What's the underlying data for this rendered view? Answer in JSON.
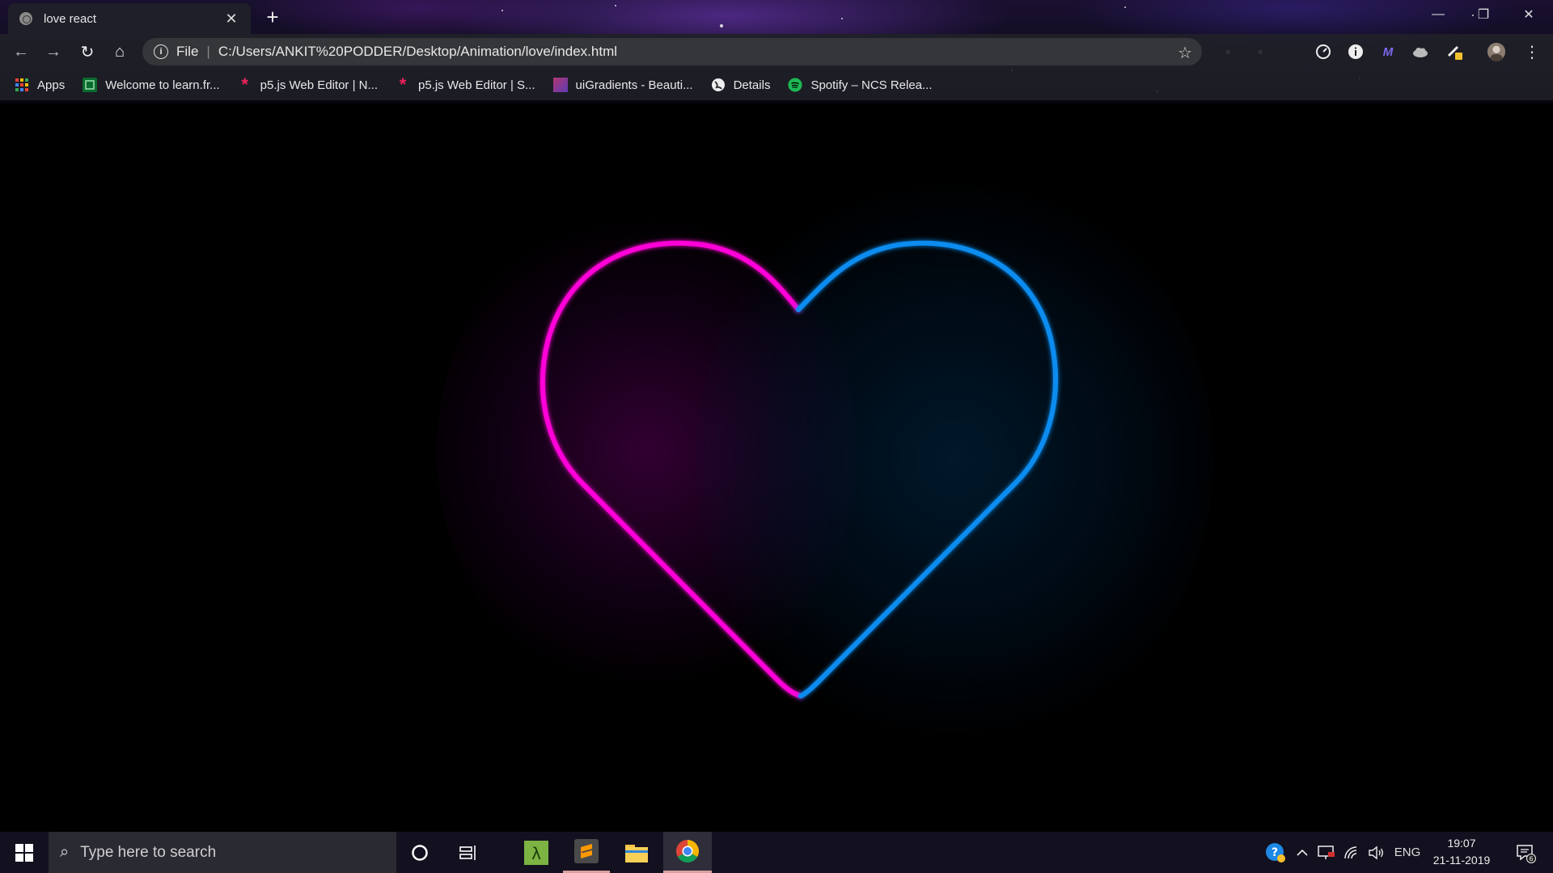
{
  "browser": {
    "tab_title": "love react",
    "new_tab_symbol": "+",
    "close_symbol": "✕",
    "window_controls": {
      "minimize": "—",
      "restore": "❐",
      "close": "✕"
    },
    "nav": {
      "back": "←",
      "forward": "→",
      "reload": "↻",
      "home": "⌂"
    },
    "address": {
      "scheme_label": "File",
      "separator": "|",
      "url": "C:/Users/ANKIT%20PODDER/Desktop/Animation/love/index.html"
    },
    "bookmark_star": "☆",
    "menu_dots": "⋮"
  },
  "bookmarks": [
    {
      "label": "Apps",
      "icon": "apps-grid-icon"
    },
    {
      "label": "Welcome to learn.fr...",
      "icon": "learn-icon"
    },
    {
      "label": "p5.js Web Editor | N...",
      "icon": "p5js-icon"
    },
    {
      "label": "p5.js Web Editor | S...",
      "icon": "p5js-icon"
    },
    {
      "label": "uiGradients - Beauti...",
      "icon": "uigradients-icon"
    },
    {
      "label": "Details",
      "icon": "globe-icon"
    },
    {
      "label": "Spotify – NCS Relea...",
      "icon": "spotify-icon"
    }
  ],
  "page": {
    "heart_left_color": "#ff00d8",
    "heart_right_color": "#0a8cf0"
  },
  "taskbar": {
    "search_placeholder": "Type here to search",
    "language": "ENG",
    "time": "19:07",
    "date": "21-11-2019",
    "notification_count": "6"
  }
}
